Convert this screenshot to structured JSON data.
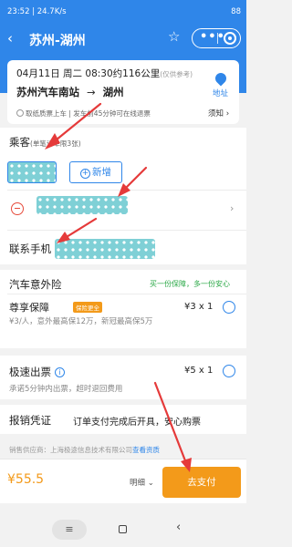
{
  "status_bar": {
    "time_speed": "23:52 | 24.7K/s",
    "battery": "88"
  },
  "nav": {
    "back": "‹",
    "title": "苏州-湖州",
    "star": "☆",
    "more": "•••"
  },
  "trip": {
    "date_line": "04月11日 周二 08:30约116公里",
    "distance_note": "(仅供参考)",
    "from": "苏州汽车南站",
    "arrow": "→",
    "to": "湖州",
    "map_label": "地址",
    "notice": "取纸质票上车 | 发车前45分钟可在线退票",
    "rules": "须知 ›"
  },
  "passenger": {
    "label": "乘客",
    "sub": "(单笔订单限3张)",
    "add_label": "新增",
    "add_plus": "+",
    "chevron": "›"
  },
  "contact": {
    "label": "联系手机"
  },
  "insurance": {
    "title": "汽车意外险",
    "promo": "买一份保障，多一份安心",
    "name": "尊享保障",
    "tag": "保险更全",
    "desc": "¥3/人，意外最高保12万，新冠最高保5万",
    "price": "¥3 x 1"
  },
  "fast_ticket": {
    "title": "极速出票",
    "info": "i",
    "desc": "承诺5分钟内出票，超时退回费用",
    "price": "¥5 x 1"
  },
  "voucher": {
    "label": "报销凭证",
    "text": "订单支付完成后开具，安心购票"
  },
  "supplier": {
    "text": "销售供应商：上海极途信息技术有限公司",
    "link": "查看资质"
  },
  "bottom": {
    "total": "¥55.5",
    "detail": "明细 ⌄",
    "pay": "去支付"
  },
  "system_nav": {
    "menu": "≡",
    "back": "‹"
  },
  "colors": {
    "primary": "#2f86e9",
    "accent": "#f39a1a",
    "annotation": "#e53a3a"
  }
}
